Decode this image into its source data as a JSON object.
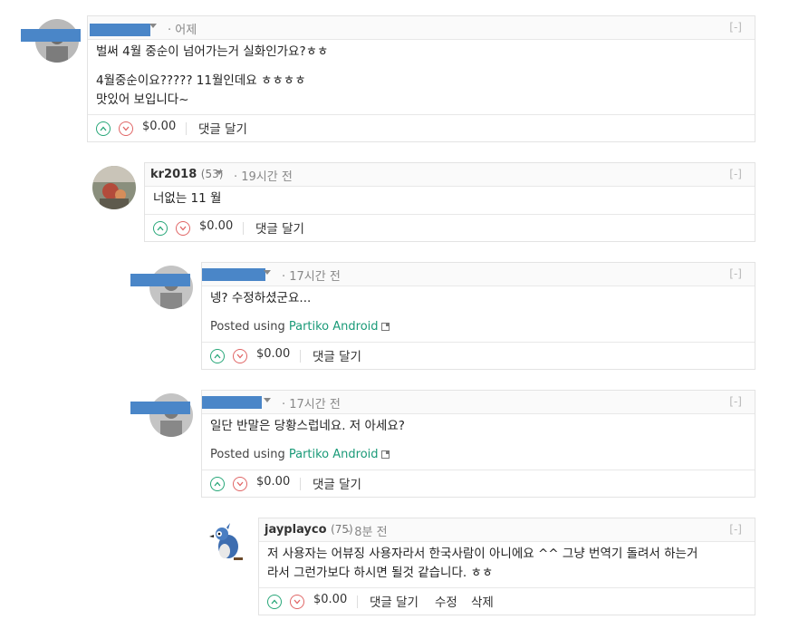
{
  "colors": {
    "accent": "#1a9a78",
    "upvote": "#28a779",
    "downvote": "#e06666",
    "redaction": "#4a86c8"
  },
  "comments": [
    {
      "author": "",
      "reputation": "",
      "time": "· 어제",
      "collapse": "[-]",
      "body_lines": [
        "벌써 4월 중순이 넘어가는거 실화인가요?ㅎㅎ"
      ],
      "reply_lines": [
        "4월중순이요????? 11월인데요 ㅎㅎㅎㅎ",
        "맛있어 보입니다~"
      ],
      "payout": "$0.00",
      "actions": [
        "댓글 달기"
      ]
    },
    {
      "author": "kr2018",
      "reputation": "(53)",
      "time": "· 19시간 전",
      "collapse": "[-]",
      "body_lines": [
        "너없는 11 월"
      ],
      "payout": "$0.00",
      "actions": [
        "댓글 달기"
      ]
    },
    {
      "author": "",
      "reputation": "",
      "time": "· 17시간 전",
      "collapse": "[-]",
      "body_lines": [
        "넹? 수정하셨군요..."
      ],
      "posted_prefix": "Posted using ",
      "posted_link": "Partiko Android",
      "payout": "$0.00",
      "actions": [
        "댓글 달기"
      ]
    },
    {
      "author": "",
      "reputation": "",
      "time": "· 17시간 전",
      "collapse": "[-]",
      "body_lines": [
        "일단 반말은 당황스럽네요. 저 아세요?"
      ],
      "posted_prefix": "Posted using ",
      "posted_link": "Partiko Android",
      "payout": "$0.00",
      "actions": [
        "댓글 달기"
      ]
    },
    {
      "author": "jayplayco",
      "reputation": "(75)",
      "time": "· 8분 전",
      "collapse": "[-]",
      "body_lines": [
        "저 사용자는 어뷰징 사용자라서 한국사람이 아니에요 ^^ 그냥 번역기 돌려서 하는거",
        "라서 그런가보다 하시면 될것 같습니다. ㅎㅎ"
      ],
      "payout": "$0.00",
      "actions": [
        "댓글 달기",
        "수정",
        "삭제"
      ]
    }
  ]
}
